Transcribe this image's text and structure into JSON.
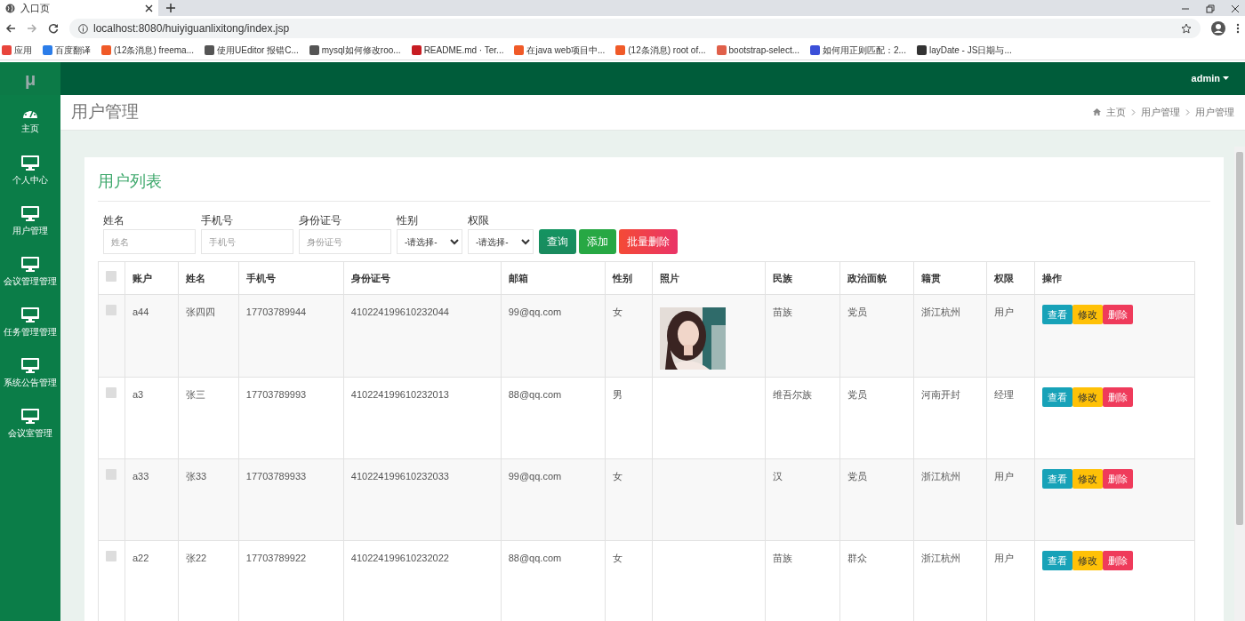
{
  "browser": {
    "tab_title": "入口页",
    "url": "localhost:8080/huiyiguanlixitong/index.jsp",
    "bookmarks": [
      {
        "label": "应用",
        "color": "#e8453c"
      },
      {
        "label": "百度翻译",
        "color": "#2b7de9"
      },
      {
        "label": "(12条消息) freema...",
        "color": "#f05a28"
      },
      {
        "label": "使用UEditor 报错C...",
        "color": "#555555"
      },
      {
        "label": "mysql如何修改roo...",
        "color": "#555555"
      },
      {
        "label": "README.md · Ter...",
        "color": "#c71d23"
      },
      {
        "label": "在java web项目中...",
        "color": "#f05a28"
      },
      {
        "label": "(12条消息) root of...",
        "color": "#f05a28"
      },
      {
        "label": "bootstrap-select...",
        "color": "#e0604a"
      },
      {
        "label": "如何用正则匹配：2...",
        "color": "#3b4fd8"
      },
      {
        "label": "layDate - JS日期与...",
        "color": "#333333"
      }
    ]
  },
  "topbar": {
    "logo": "μ",
    "user": "admin"
  },
  "sidebar": {
    "items": [
      {
        "label": "主页",
        "kind": "gauge"
      },
      {
        "label": "个人中心",
        "kind": "monitor"
      },
      {
        "label": "用户管理",
        "kind": "monitor"
      },
      {
        "label": "会议管理管理",
        "kind": "monitor"
      },
      {
        "label": "任务管理管理",
        "kind": "monitor"
      },
      {
        "label": "系统公告管理",
        "kind": "monitor"
      },
      {
        "label": "会议室管理",
        "kind": "monitor"
      }
    ]
  },
  "page_header": {
    "title": "用户管理",
    "breadcrumb": [
      "主页",
      "用户管理",
      "用户管理"
    ]
  },
  "card": {
    "title": "用户列表",
    "filters": [
      {
        "kind": "input",
        "label": "姓名",
        "placeholder": "姓名"
      },
      {
        "kind": "input",
        "label": "手机号",
        "placeholder": "手机号"
      },
      {
        "kind": "input",
        "label": "身份证号",
        "placeholder": "身份证号"
      },
      {
        "kind": "select",
        "label": "性别",
        "value": "-请选择-"
      },
      {
        "kind": "select",
        "label": "权限",
        "value": "-请选择-"
      }
    ],
    "buttons": [
      {
        "label": "查询",
        "kind": "search"
      },
      {
        "label": "添加",
        "kind": "add"
      },
      {
        "label": "批量删除",
        "kind": "delete"
      }
    ]
  },
  "table": {
    "header_checked": false,
    "columns": [
      "账户",
      "姓名",
      "手机号",
      "身份证号",
      "邮箱",
      "性别",
      "照片",
      "民族",
      "政治面貌",
      "籍贯",
      "权限",
      "操作"
    ],
    "rows": [
      {
        "checked": false,
        "cells": [
          "a44",
          "张四四",
          "17703789944",
          "410224199610232044",
          "99@qq.com",
          "女"
        ],
        "photo": {
          "kind": "picture"
        },
        "cells2": [
          "苗族",
          "党员",
          "浙江杭州",
          "用户"
        ],
        "actions": [
          {
            "label": "查看",
            "kind": "view"
          },
          {
            "label": "修改",
            "kind": "edit"
          },
          {
            "label": "删除",
            "kind": "delete"
          }
        ]
      },
      {
        "checked": false,
        "cells": [
          "a3",
          "张三",
          "17703789993",
          "410224199610232013",
          "88@qq.com",
          "男"
        ],
        "cells2": [
          "维吾尔族",
          "党员",
          "河南开封",
          "经理"
        ],
        "actions": [
          {
            "label": "查看",
            "kind": "view"
          },
          {
            "label": "修改",
            "kind": "edit"
          },
          {
            "label": "删除",
            "kind": "delete"
          }
        ]
      },
      {
        "checked": false,
        "cells": [
          "a33",
          "张33",
          "17703789933",
          "410224199610232033",
          "99@qq.com",
          "女"
        ],
        "cells2": [
          "汉",
          "党员",
          "浙江杭州",
          "用户"
        ],
        "actions": [
          {
            "label": "查看",
            "kind": "view"
          },
          {
            "label": "修改",
            "kind": "edit"
          },
          {
            "label": "删除",
            "kind": "delete"
          }
        ]
      },
      {
        "checked": false,
        "cells": [
          "a22",
          "张22",
          "17703789922",
          "410224199610232022",
          "88@qq.com",
          "女"
        ],
        "cells2": [
          "苗族",
          "群众",
          "浙江杭州",
          "用户"
        ],
        "actions": [
          {
            "label": "查看",
            "kind": "view"
          },
          {
            "label": "修改",
            "kind": "edit"
          },
          {
            "label": "删除",
            "kind": "delete"
          }
        ]
      }
    ]
  }
}
